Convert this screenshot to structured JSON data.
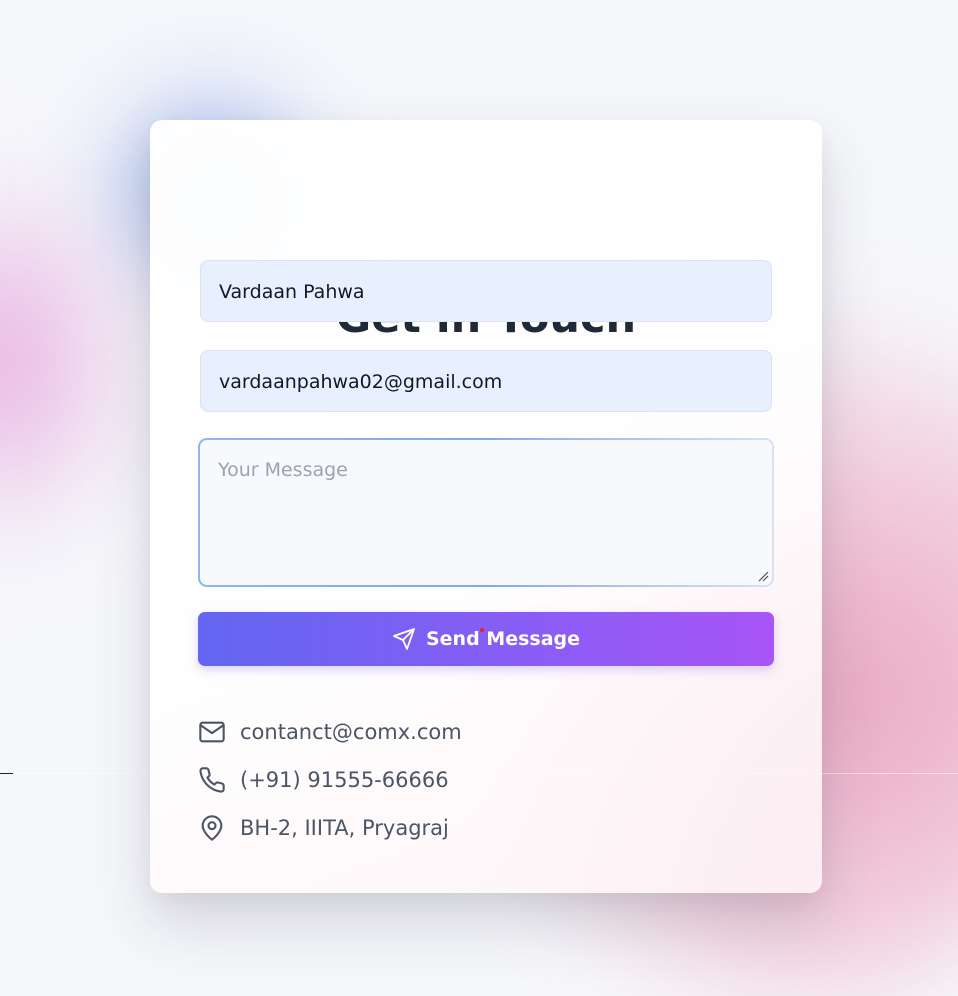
{
  "form": {
    "title": "Get in Touch",
    "name_value": "Vardaan Pahwa",
    "email_value": "vardaanpahwa02@gmail.com",
    "message_placeholder": "Your Message",
    "send_label": "Send Message"
  },
  "contact": {
    "email": "contanct@comx.com",
    "phone": "(+91) 91555-66666",
    "address": "BH-2, IIITA, Pryagraj"
  },
  "icons": {
    "send": "send-icon",
    "email": "mail-icon",
    "phone": "phone-icon",
    "address": "map-pin-icon"
  },
  "colors": {
    "title": "#1f2937",
    "button_gradient_start": "#6366f1",
    "button_gradient_end": "#a855f7",
    "field_bg": "#e8effd",
    "contact_text": "#4b5563"
  }
}
